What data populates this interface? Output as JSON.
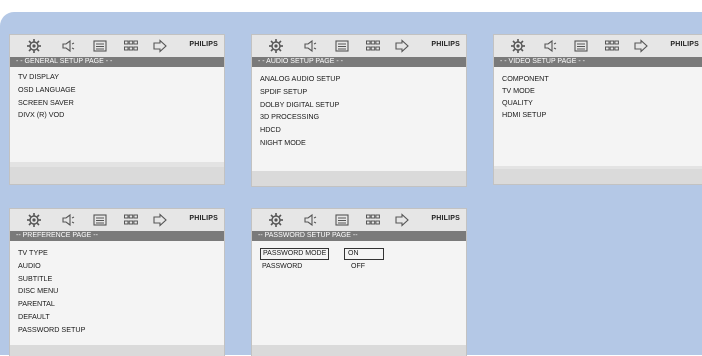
{
  "brand": "PHILIPS",
  "toolbar_icons": [
    "gear-icon",
    "speaker-icon",
    "screen-icon",
    "grid-icon",
    "arrow-right-icon"
  ],
  "panels": {
    "general": {
      "title": "- - GENERAL  SETUP  PAGE - -",
      "items": [
        "TV DISPLAY",
        "OSD LANGUAGE",
        "SCREEN SAVER",
        "DIVX (R) VOD"
      ]
    },
    "audio": {
      "title": "- - AUDIO  SETUP  PAGE - -",
      "items": [
        "ANALOG AUDIO SETUP",
        "SPDIF SETUP",
        "DOLBY DIGITAL SETUP",
        "3D PROCESSING",
        "HDCD",
        "NIGHT MODE"
      ]
    },
    "video": {
      "title": "- - VIDEO SETUP PAGE - -",
      "items": [
        "COMPONENT",
        "TV MODE",
        "QUALITY",
        "HDMI SETUP"
      ]
    },
    "preference": {
      "title": "-- PREFERENCE PAGE --",
      "items": [
        "TV TYPE",
        "AUDIO",
        "SUBTITLE",
        "DISC MENU",
        "PARENTAL",
        "DEFAULT",
        "PASSWORD SETUP"
      ]
    },
    "password": {
      "title": "-- PASSWORD SETUP PAGE --",
      "rows": [
        {
          "label": "PASSWORD MODE",
          "value": "ON"
        },
        {
          "label": "PASSWORD",
          "value": "OFF"
        }
      ]
    }
  }
}
